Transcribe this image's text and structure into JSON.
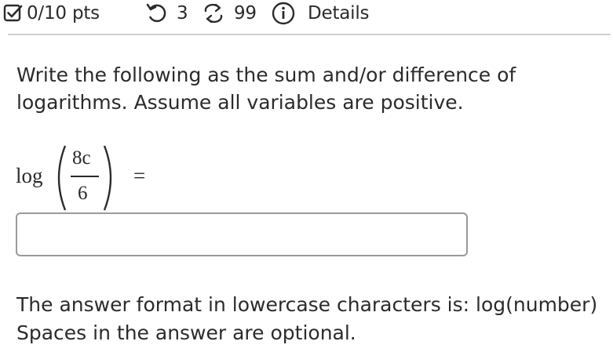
{
  "status": {
    "score": "0/10 pts",
    "attempts_remaining": "3",
    "submissions_remaining": "99",
    "details_label": "Details"
  },
  "icons": {
    "score": "checkbox-icon",
    "attempts": "undo-icon",
    "submissions": "retry-icon",
    "details": "info-icon"
  },
  "question": {
    "prompt_line1": "Write the following as the sum and/or difference of",
    "prompt_line2": "logarithms. Assume all variables are positive.",
    "expression": {
      "function": "log",
      "numerator": "8c",
      "denominator": "6",
      "relation": "="
    }
  },
  "answer": {
    "value": "",
    "placeholder": ""
  },
  "hint": {
    "line1": "The answer format in lowercase characters is: log(number)",
    "line2": "Spaces in the answer are optional."
  },
  "colors": {
    "text": "#2b2b2b",
    "divider": "#d0d0d0",
    "input_border": "#9a9a9a"
  }
}
